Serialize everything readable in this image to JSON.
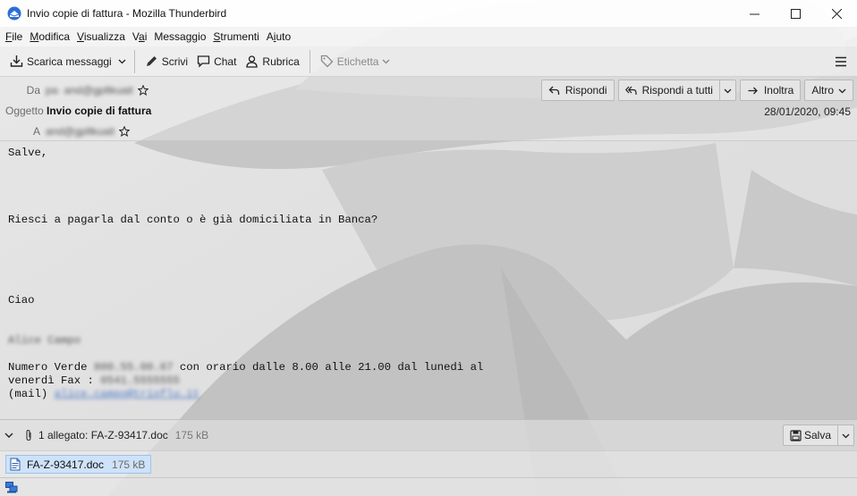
{
  "window": {
    "title": "Invio copie di fattura - Mozilla Thunderbird"
  },
  "menubar": {
    "items": [
      {
        "label": "File",
        "accel": "F",
        "rest": "ile"
      },
      {
        "label": "Modifica",
        "accel": "M",
        "rest": "odifica"
      },
      {
        "label": "Visualizza",
        "accel": "V",
        "rest": "isualizza"
      },
      {
        "label": "Vai",
        "pre": "V",
        "accel": "a",
        "rest": "i"
      },
      {
        "label": "Messaggio",
        "pre": "Messa",
        "accel": "g",
        "rest": "gio"
      },
      {
        "label": "Strumenti",
        "accel": "S",
        "rest": "trumenti"
      },
      {
        "label": "Aiuto",
        "pre": "A",
        "accel": "i",
        "rest": "uto"
      }
    ]
  },
  "toolbar": {
    "get_messages": "Scarica messaggi",
    "write": "Scrivi",
    "chat": "Chat",
    "address_book": "Rubrica",
    "tag": "Etichetta"
  },
  "header": {
    "from_label": "Da",
    "from_value": "pa· and@gpltkuait",
    "subject_label": "Oggetto",
    "subject_value": "Invio copie di fattura",
    "to_label": "A",
    "to_value": "and@gpltkuait",
    "date": "28/01/2020, 09:45",
    "reply": "Rispondi",
    "reply_all": "Rispondi a tutti",
    "forward": "Inoltra",
    "more": "Altro"
  },
  "body": {
    "greeting": "Salve,",
    "question": "Riesci a pagarla dal conto o è già domiciliata in Banca?",
    "closing": "Ciao",
    "signature_name": "Alice Campo",
    "signature_line1_prefix": "Numero Verde ",
    "signature_phone": "800.55.00.67",
    "signature_line1_suffix": " con orario dalle 8.00 alle 21.00 dal lunedì al",
    "signature_line2_prefix": "venerdì Fax : ",
    "signature_fax": "0541.5555555",
    "signature_line3_prefix": "(mail) ",
    "signature_mail": "alice.campo@trioflu.it"
  },
  "attachments": {
    "summary": "1 allegato: FA-Z-93417.doc",
    "summary_size": "175 kB",
    "save": "Salva",
    "items": [
      {
        "name": "FA-Z-93417.doc",
        "size": "175 kB"
      }
    ]
  },
  "colors": {
    "chip_bg": "#cce1fa",
    "chip_border": "#9fc1e6",
    "link": "#4a78c8"
  }
}
